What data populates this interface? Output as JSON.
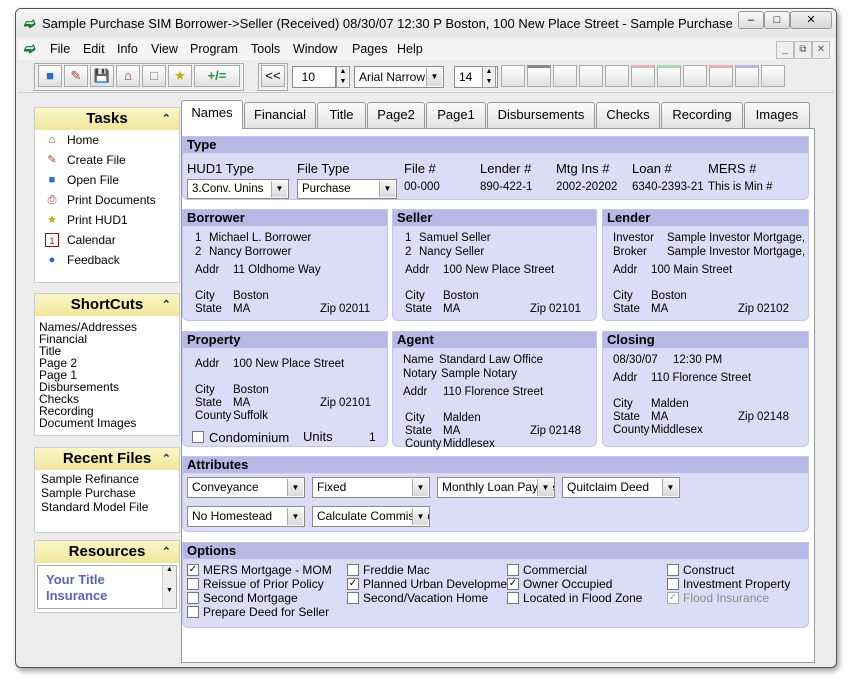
{
  "window": {
    "title": "Sample Purchase SIM Borrower->Seller (Received) 08/30/07 12:30 P Boston, 100 New Place Street - Sample Purchase SIM Borro..."
  },
  "menu": [
    "File",
    "Edit",
    "Info",
    "View",
    "Program",
    "Tools",
    "Window",
    "Pages",
    "Help"
  ],
  "toolbar": {
    "nav_back": "<<",
    "page_num": "10",
    "font_name": "Arial Narrow",
    "font_size": "14",
    "plus_eq": "+/="
  },
  "tasks": {
    "title": "Tasks",
    "items": [
      "Home",
      "Create File",
      "Open File",
      "Print Documents",
      "Print HUD1",
      "Calendar",
      "Feedback"
    ]
  },
  "shortcuts": {
    "title": "ShortCuts",
    "items": [
      "Names/Addresses",
      "Financial",
      "Title",
      "Page 2",
      "Page 1",
      "Disbursements",
      "Checks",
      "Recording",
      "Document Images"
    ]
  },
  "recent": {
    "title": "Recent Files",
    "items": [
      "Sample Refinance",
      "Sample Purchase",
      "Standard Model File"
    ]
  },
  "resources": {
    "title": "Resources",
    "line1": "Your Title",
    "line2": "Insurance"
  },
  "tabs": [
    "Names",
    "Financial",
    "Title",
    "Page2",
    "Page1",
    "Disbursements",
    "Checks",
    "Recording",
    "Images"
  ],
  "type": {
    "header": "Type",
    "hud1_label": "HUD1 Type",
    "hud1_value": "3.Conv. Unins",
    "filetype_label": "File Type",
    "filetype_value": "Purchase",
    "file_label": "File #",
    "file_value": "00-000",
    "lender_label": "Lender #",
    "lender_value": "890-422-1",
    "mtg_label": "Mtg Ins #",
    "mtg_value": "2002-20202",
    "loan_label": "Loan #",
    "loan_value": "6340-2393-21",
    "mers_label": "MERS #",
    "mers_value": "This is Min #"
  },
  "borrower": {
    "header": "Borrower",
    "n1": "1",
    "name1": "Michael L. Borrower",
    "n2": "2",
    "name2": "Nancy Borrower",
    "addr_l": "Addr",
    "addr": "11 Oldhome Way",
    "city_l": "City",
    "city": "Boston",
    "state_l": "State",
    "state": "MA",
    "zip_l": "Zip",
    "zip": "02011"
  },
  "seller": {
    "header": "Seller",
    "n1": "1",
    "name1": "Samuel Seller",
    "n2": "2",
    "name2": "Nancy Seller",
    "addr_l": "Addr",
    "addr": "100 New Place Street",
    "city_l": "City",
    "city": "Boston",
    "state_l": "State",
    "state": "MA",
    "zip_l": "Zip",
    "zip": "02101"
  },
  "lender": {
    "header": "Lender",
    "inv_l": "Investor",
    "inv": "Sample Investor Mortgage, I",
    "brk_l": "Broker",
    "brk": "Sample Investor Mortgage, I",
    "addr_l": "Addr",
    "addr": "100 Main Street",
    "city_l": "City",
    "city": "Boston",
    "state_l": "State",
    "state": "MA",
    "zip_l": "Zip",
    "zip": "02102"
  },
  "property": {
    "header": "Property",
    "addr_l": "Addr",
    "addr": "100 New Place Street",
    "city_l": "City",
    "city": "Boston",
    "state_l": "State",
    "state": "MA",
    "zip_l": "Zip",
    "zip": "02101",
    "county_l": "County",
    "county": "Suffolk",
    "condo": "Condominium",
    "units_l": "Units",
    "units": "1"
  },
  "agent": {
    "header": "Agent",
    "name_l": "Name",
    "name": "Standard Law Office",
    "notary_l": "Notary",
    "notary": "Sample Notary",
    "addr_l": "Addr",
    "addr": "110 Florence Street",
    "city_l": "City",
    "city": "Malden",
    "state_l": "State",
    "state": "MA",
    "zip_l": "Zip",
    "zip": "02148",
    "county_l": "County",
    "county": "Middlesex"
  },
  "closing": {
    "header": "Closing",
    "date": "08/30/07",
    "time": "12:30 PM",
    "addr_l": "Addr",
    "addr": "110 Florence Street",
    "city_l": "City",
    "city": "Malden",
    "state_l": "State",
    "state": "MA",
    "zip_l": "Zip",
    "zip": "02148",
    "county_l": "County",
    "county": "Middlesex"
  },
  "attributes": {
    "header": "Attributes",
    "a1": "Conveyance",
    "a2": "Fixed",
    "a3": "Monthly Loan Payme",
    "a4": "Quitclaim Deed",
    "a5": "No Homestead",
    "a6": "Calculate Commissio"
  },
  "options": {
    "header": "Options",
    "items": [
      {
        "label": "MERS  Mortgage - MOM",
        "checked": true
      },
      {
        "label": "Reissue of Prior Policy",
        "checked": false
      },
      {
        "label": "Second Mortgage",
        "checked": false
      },
      {
        "label": "Prepare Deed for Seller",
        "checked": false
      },
      {
        "label": "Freddie Mac",
        "checked": false
      },
      {
        "label": "Planned Urban Development",
        "checked": true
      },
      {
        "label": "Second/Vacation Home",
        "checked": false
      },
      {
        "label": "Commercial",
        "checked": false
      },
      {
        "label": "Owner Occupied",
        "checked": true
      },
      {
        "label": "Located in Flood Zone",
        "checked": false
      },
      {
        "label": "Construct",
        "checked": false
      },
      {
        "label": "Investment Property",
        "checked": false
      },
      {
        "label": "Flood Insurance",
        "checked": true
      }
    ]
  }
}
